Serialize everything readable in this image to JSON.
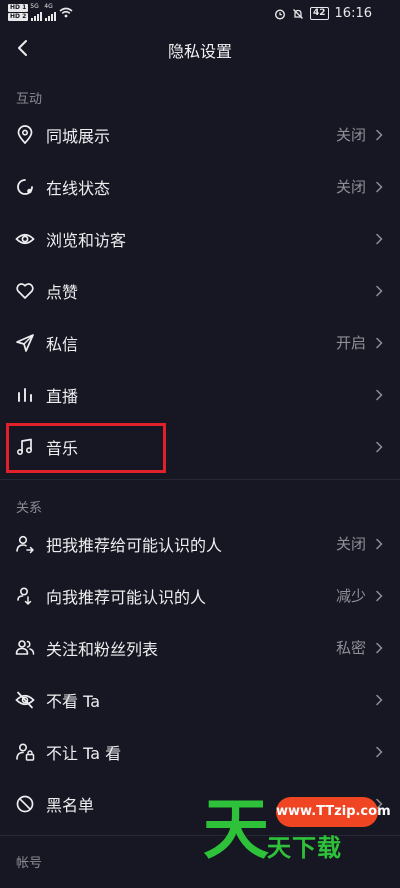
{
  "status_bar": {
    "sim1_badge": "HD 1",
    "sim2_badge": "HD 2",
    "net1": "5G",
    "net2": "4G",
    "battery": "42",
    "time": "16:16"
  },
  "header": {
    "title": "隐私设置",
    "back_icon": "back-arrow-icon"
  },
  "sections": [
    {
      "title": "互动",
      "items": [
        {
          "label": "同城展示",
          "value": "关闭",
          "icon": "location-pin-icon"
        },
        {
          "label": "在线状态",
          "value": "关闭",
          "icon": "online-status-icon"
        },
        {
          "label": "浏览和访客",
          "value": "",
          "icon": "eye-icon"
        },
        {
          "label": "点赞",
          "value": "",
          "icon": "heart-icon"
        },
        {
          "label": "私信",
          "value": "开启",
          "icon": "paper-plane-icon"
        },
        {
          "label": "直播",
          "value": "",
          "icon": "live-bars-icon"
        },
        {
          "label": "音乐",
          "value": "",
          "icon": "music-note-icon"
        }
      ]
    },
    {
      "title": "关系",
      "items": [
        {
          "label": "把我推荐给可能认识的人",
          "value": "关闭",
          "icon": "user-share-icon"
        },
        {
          "label": "向我推荐可能认识的人",
          "value": "减少",
          "icon": "user-recommend-icon"
        },
        {
          "label": "关注和粉丝列表",
          "value": "私密",
          "icon": "users-icon"
        },
        {
          "label": "不看 Ta",
          "value": "",
          "icon": "eye-off-icon"
        },
        {
          "label": "不让 Ta 看",
          "value": "",
          "icon": "user-lock-icon"
        },
        {
          "label": "黑名单",
          "value": "",
          "icon": "block-icon"
        }
      ]
    },
    {
      "title": "帐号",
      "items": []
    }
  ],
  "watermark": {
    "big_char": "天",
    "url": "www.TTzip.com",
    "text": "天下载"
  },
  "colors": {
    "background": "#161722",
    "highlight": "#e0212b",
    "watermark_green": "#2ec23a",
    "watermark_orange": "#ef4523"
  }
}
